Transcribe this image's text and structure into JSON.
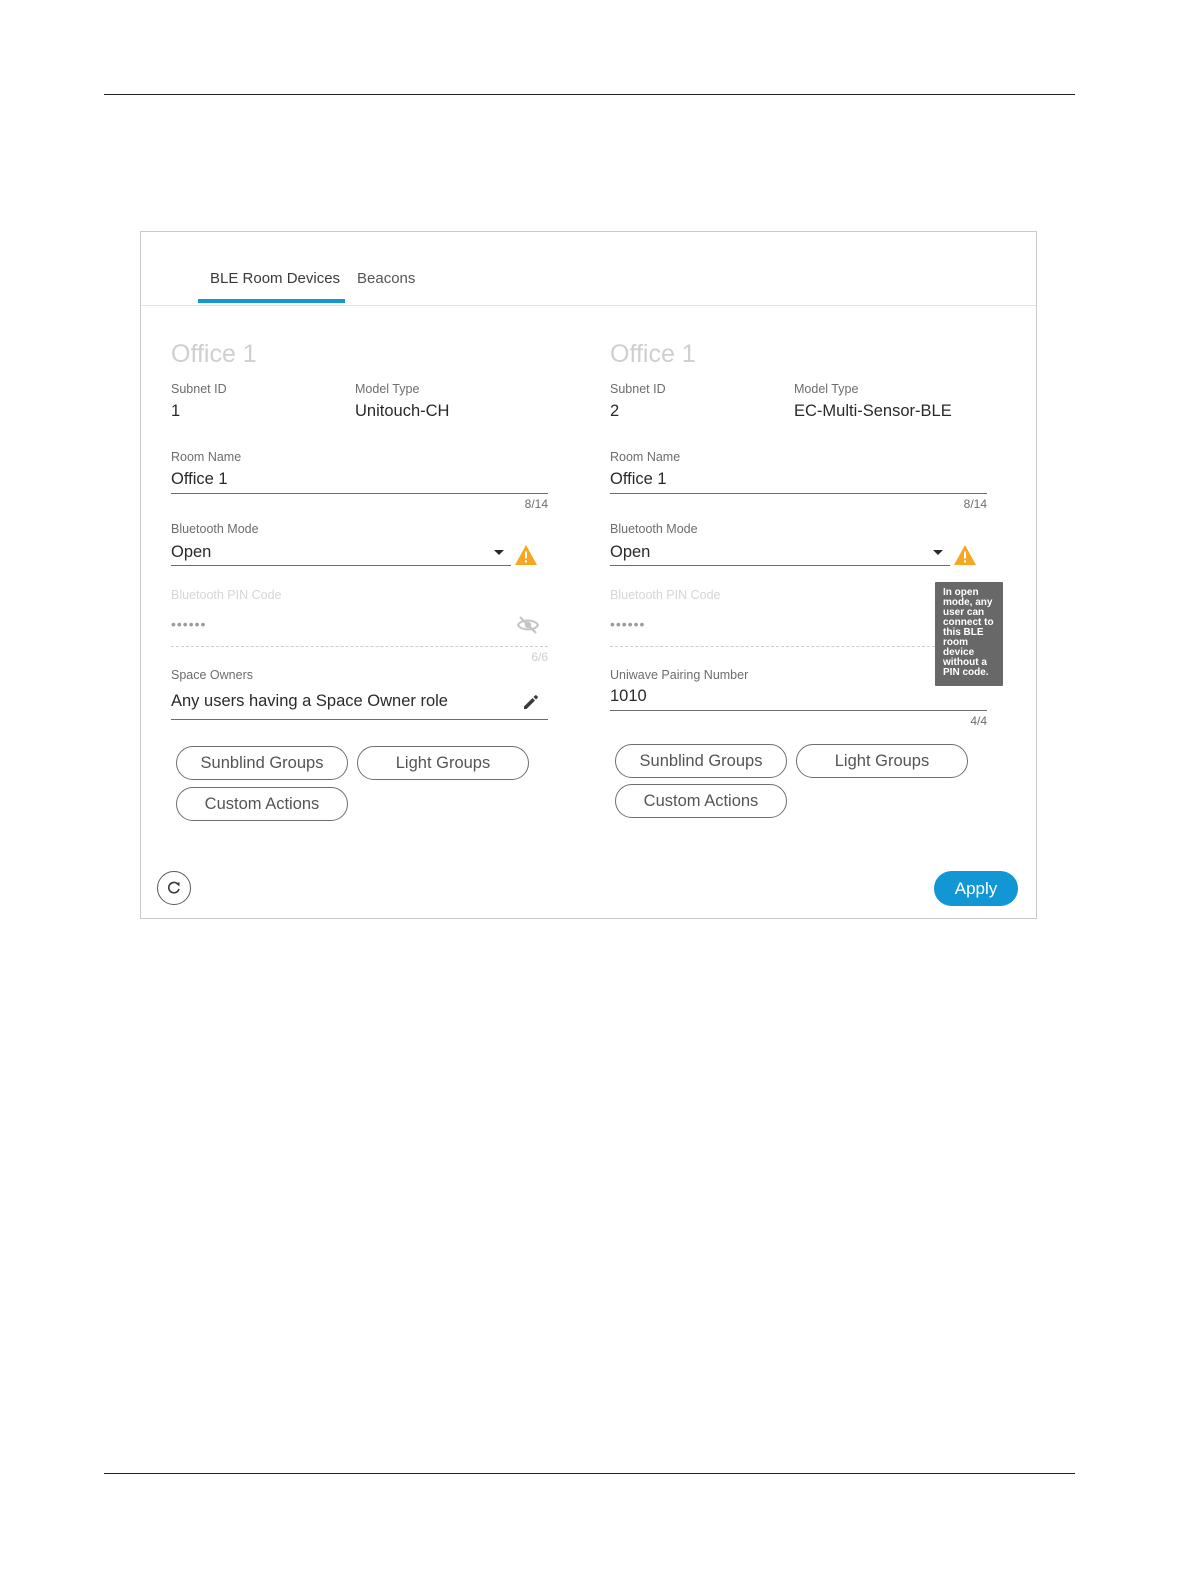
{
  "tabs": [
    {
      "label": "BLE Room Devices",
      "active": true
    },
    {
      "label": "Beacons",
      "active": false
    }
  ],
  "devices": [
    {
      "title": "Office 1",
      "subnet_label": "Subnet ID",
      "subnet_value": "1",
      "model_label": "Model Type",
      "model_value": "Unitouch-CH",
      "room_name_label": "Room Name",
      "room_name_value": "Office 1",
      "room_name_counter": "8/14",
      "bt_mode_label": "Bluetooth Mode",
      "bt_mode_value": "Open",
      "pin_label": "Bluetooth PIN Code",
      "pin_value": "••••••",
      "pin_counter": "6/6",
      "owners_label": "Space Owners",
      "owners_value": "Any users having a Space Owner role",
      "buttons": {
        "sunblind": "Sunblind Groups",
        "light": "Light Groups",
        "custom": "Custom Actions"
      }
    },
    {
      "title": "Office 1",
      "subnet_label": "Subnet ID",
      "subnet_value": "2",
      "model_label": "Model Type",
      "model_value": "EC-Multi-Sensor-BLE",
      "room_name_label": "Room Name",
      "room_name_value": "Office 1",
      "room_name_counter": "8/14",
      "bt_mode_label": "Bluetooth Mode",
      "bt_mode_value": "Open",
      "pin_label": "Bluetooth PIN Code",
      "pin_value": "••••••",
      "pairing_label": "Uniwave Pairing Number",
      "pairing_value": "1010",
      "pairing_counter": "4/4",
      "tooltip": "In open mode, any user can connect to this BLE room device without a PIN code.",
      "buttons": {
        "sunblind": "Sunblind Groups",
        "light": "Light Groups",
        "custom": "Custom Actions"
      }
    }
  ],
  "footer": {
    "apply_label": "Apply"
  },
  "colors": {
    "accent": "#1296d4",
    "warning": "#f5a623",
    "tooltip_bg": "#686868"
  },
  "icons": [
    "warning-icon",
    "visibility-off-icon",
    "pencil-icon",
    "refresh-icon",
    "caret-down-icon"
  ]
}
